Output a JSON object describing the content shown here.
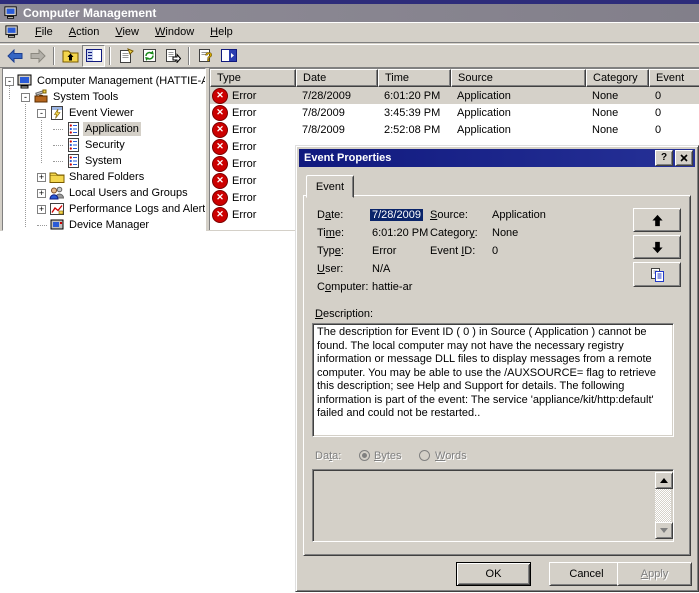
{
  "colors": {
    "face": "#D4D0C8",
    "title_active": "#10197E",
    "title_inactive": "#87848D",
    "error_red": "#CC0000",
    "selection_navy": "#0A246A"
  },
  "window": {
    "title": "Computer Management",
    "menus": [
      "&File",
      "&Action",
      "&View",
      "&Window",
      "&Help"
    ],
    "toolbar_icons": [
      "back",
      "forward",
      "up-one-level",
      "show-console-tree",
      "properties",
      "refresh",
      "export-list",
      "help",
      "show-action-pane"
    ]
  },
  "tree": {
    "items": [
      {
        "label": "Computer Management (HATTIE-AR",
        "expander": "-",
        "icon": "computer"
      },
      {
        "label": "System Tools",
        "expander": "-",
        "icon": "system-tools"
      },
      {
        "label": "Event Viewer",
        "expander": "-",
        "icon": "event-viewer"
      },
      {
        "label": "Application",
        "icon": "event-log",
        "selected": true
      },
      {
        "label": "Security",
        "icon": "event-log"
      },
      {
        "label": "System",
        "icon": "event-log"
      },
      {
        "label": "Shared Folders",
        "expander": "+",
        "icon": "shared-folders"
      },
      {
        "label": "Local Users and Groups",
        "expander": "+",
        "icon": "users"
      },
      {
        "label": "Performance Logs and Alert:",
        "expander": "+",
        "icon": "performance"
      },
      {
        "label": "Device Manager",
        "icon": "device-manager"
      }
    ]
  },
  "list": {
    "columns": [
      "Type",
      "Date",
      "Time",
      "Source",
      "Category",
      "Event"
    ],
    "rows": [
      {
        "type": "Error",
        "date": "7/28/2009",
        "time": "6:01:20 PM",
        "source": "Application",
        "category": "None",
        "event": "0",
        "selected": true
      },
      {
        "type": "Error",
        "date": "7/8/2009",
        "time": "3:45:39 PM",
        "source": "Application",
        "category": "None",
        "event": "0"
      },
      {
        "type": "Error",
        "date": "7/8/2009",
        "time": "2:52:08 PM",
        "source": "Application",
        "category": "None",
        "event": "0"
      },
      {
        "type": "Error"
      },
      {
        "type": "Error"
      },
      {
        "type": "Error"
      },
      {
        "type": "Error"
      },
      {
        "type": "Error"
      }
    ]
  },
  "dialog": {
    "title": "Event Properties",
    "titlebar_help": "?",
    "tab": "Event",
    "fields": {
      "date_label": "D&ate:",
      "date_value": "7/28/2009",
      "time_label": "Ti&me:",
      "time_value": "6:01:20 PM",
      "type_label": "Typ&e:",
      "type_value": "Error",
      "user_label": "&User:",
      "user_value": "N/A",
      "computer_label": "C&omputer:",
      "computer_value": "hattie-ar",
      "source_label": "&Source:",
      "source_value": "Application",
      "category_label": "Categor&y:",
      "category_value": "None",
      "eventid_label": "Event &ID:",
      "eventid_value": "0"
    },
    "description_label": "&Description:",
    "description_text": "The description for Event ID ( 0 ) in Source ( Application ) cannot be found. The local computer may not have the necessary registry information or message DLL files to display messages from a remote computer. You may be able to use the /AUXSOURCE= flag to retrieve this description; see Help and Support for details. The following information is part of the event: The service 'appliance/kit/http:default' failed and could not be restarted..",
    "data_label": "Da&ta:",
    "bytes_label": "&Bytes",
    "words_label": "&Words",
    "ok_label": "OK",
    "cancel_label": "Cancel",
    "apply_label": "&Apply"
  }
}
